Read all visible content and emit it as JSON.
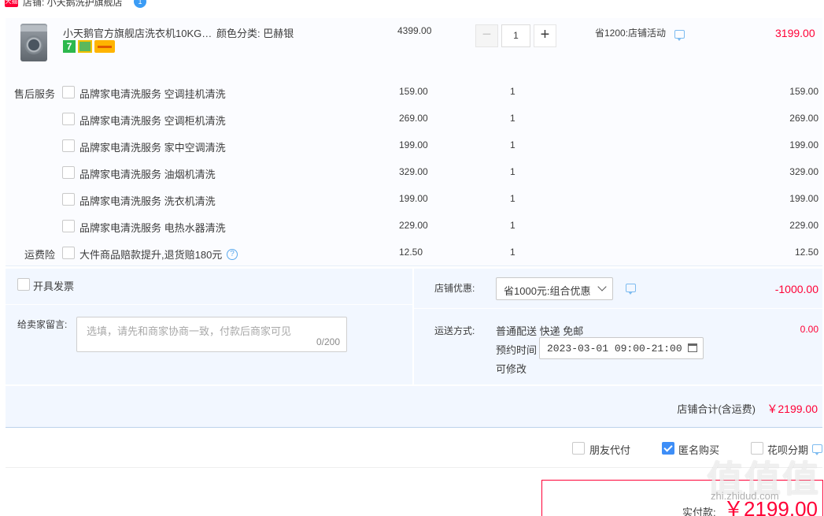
{
  "store": {
    "logo_text": "天猫",
    "label": "店铺: 小天鹅洗护旗舰店",
    "badge": "1"
  },
  "item": {
    "title": "小天鹅官方旗舰店洗衣机10KG…",
    "color": "颜色分类: 巴赫银",
    "orig_price": "4399.00",
    "quantity": "1",
    "minus": "−",
    "plus": "+",
    "promo": "省1200:店铺活动",
    "final_price": "3199.00",
    "badge_7": "7"
  },
  "services": {
    "section_label": "售后服务",
    "rows": [
      {
        "name": "品牌家电清洗服务 空调挂机清洗",
        "price": "159.00",
        "qty": "1",
        "total": "159.00"
      },
      {
        "name": "品牌家电清洗服务 空调柜机清洗",
        "price": "269.00",
        "qty": "1",
        "total": "269.00"
      },
      {
        "name": "品牌家电清洗服务 家中空调清洗",
        "price": "199.00",
        "qty": "1",
        "total": "199.00"
      },
      {
        "name": "品牌家电清洗服务 油烟机清洗",
        "price": "329.00",
        "qty": "1",
        "total": "329.00"
      },
      {
        "name": "品牌家电清洗服务 洗衣机清洗",
        "price": "199.00",
        "qty": "1",
        "total": "199.00"
      },
      {
        "name": "品牌家电清洗服务 电热水器清洗",
        "price": "229.00",
        "qty": "1",
        "total": "229.00"
      }
    ]
  },
  "insurance": {
    "label": "运费险",
    "name": "大件商品赔款提升,退货赔180元",
    "help": "?",
    "price": "12.50",
    "qty": "1",
    "total": "12.50"
  },
  "invoice": {
    "label": "开具发票"
  },
  "message": {
    "label": "给卖家留言:",
    "placeholder": "选填，请先和商家协商一致，付款后商家可见",
    "count": "0/200"
  },
  "discount": {
    "label": "店铺优惠:",
    "selected": "省1000元:组合优惠",
    "amount": "-1000.00"
  },
  "shipping": {
    "label": "运送方式:",
    "method": "普通配送 快递 免邮",
    "appointment_label": "预约时间",
    "appointment_value": "2023-03-01 09:00-21:00",
    "editable": "可修改",
    "fee": "0.00"
  },
  "summary": {
    "label": "店铺合计(含运费)",
    "value": "￥2199.00"
  },
  "options": {
    "friend_pay": "朋友代付",
    "anonymous": "匿名购买",
    "installment": "花呗分期"
  },
  "payment": {
    "label": "实付款:",
    "value": "￥2199.00"
  },
  "watermark": {
    "main": "值值值",
    "sub": "zhi.zhidud.com"
  },
  "colors": {
    "accent_red": "#ff0036",
    "accent_blue": "#3e8ef7",
    "panel_bg": "#f2f7ff"
  }
}
